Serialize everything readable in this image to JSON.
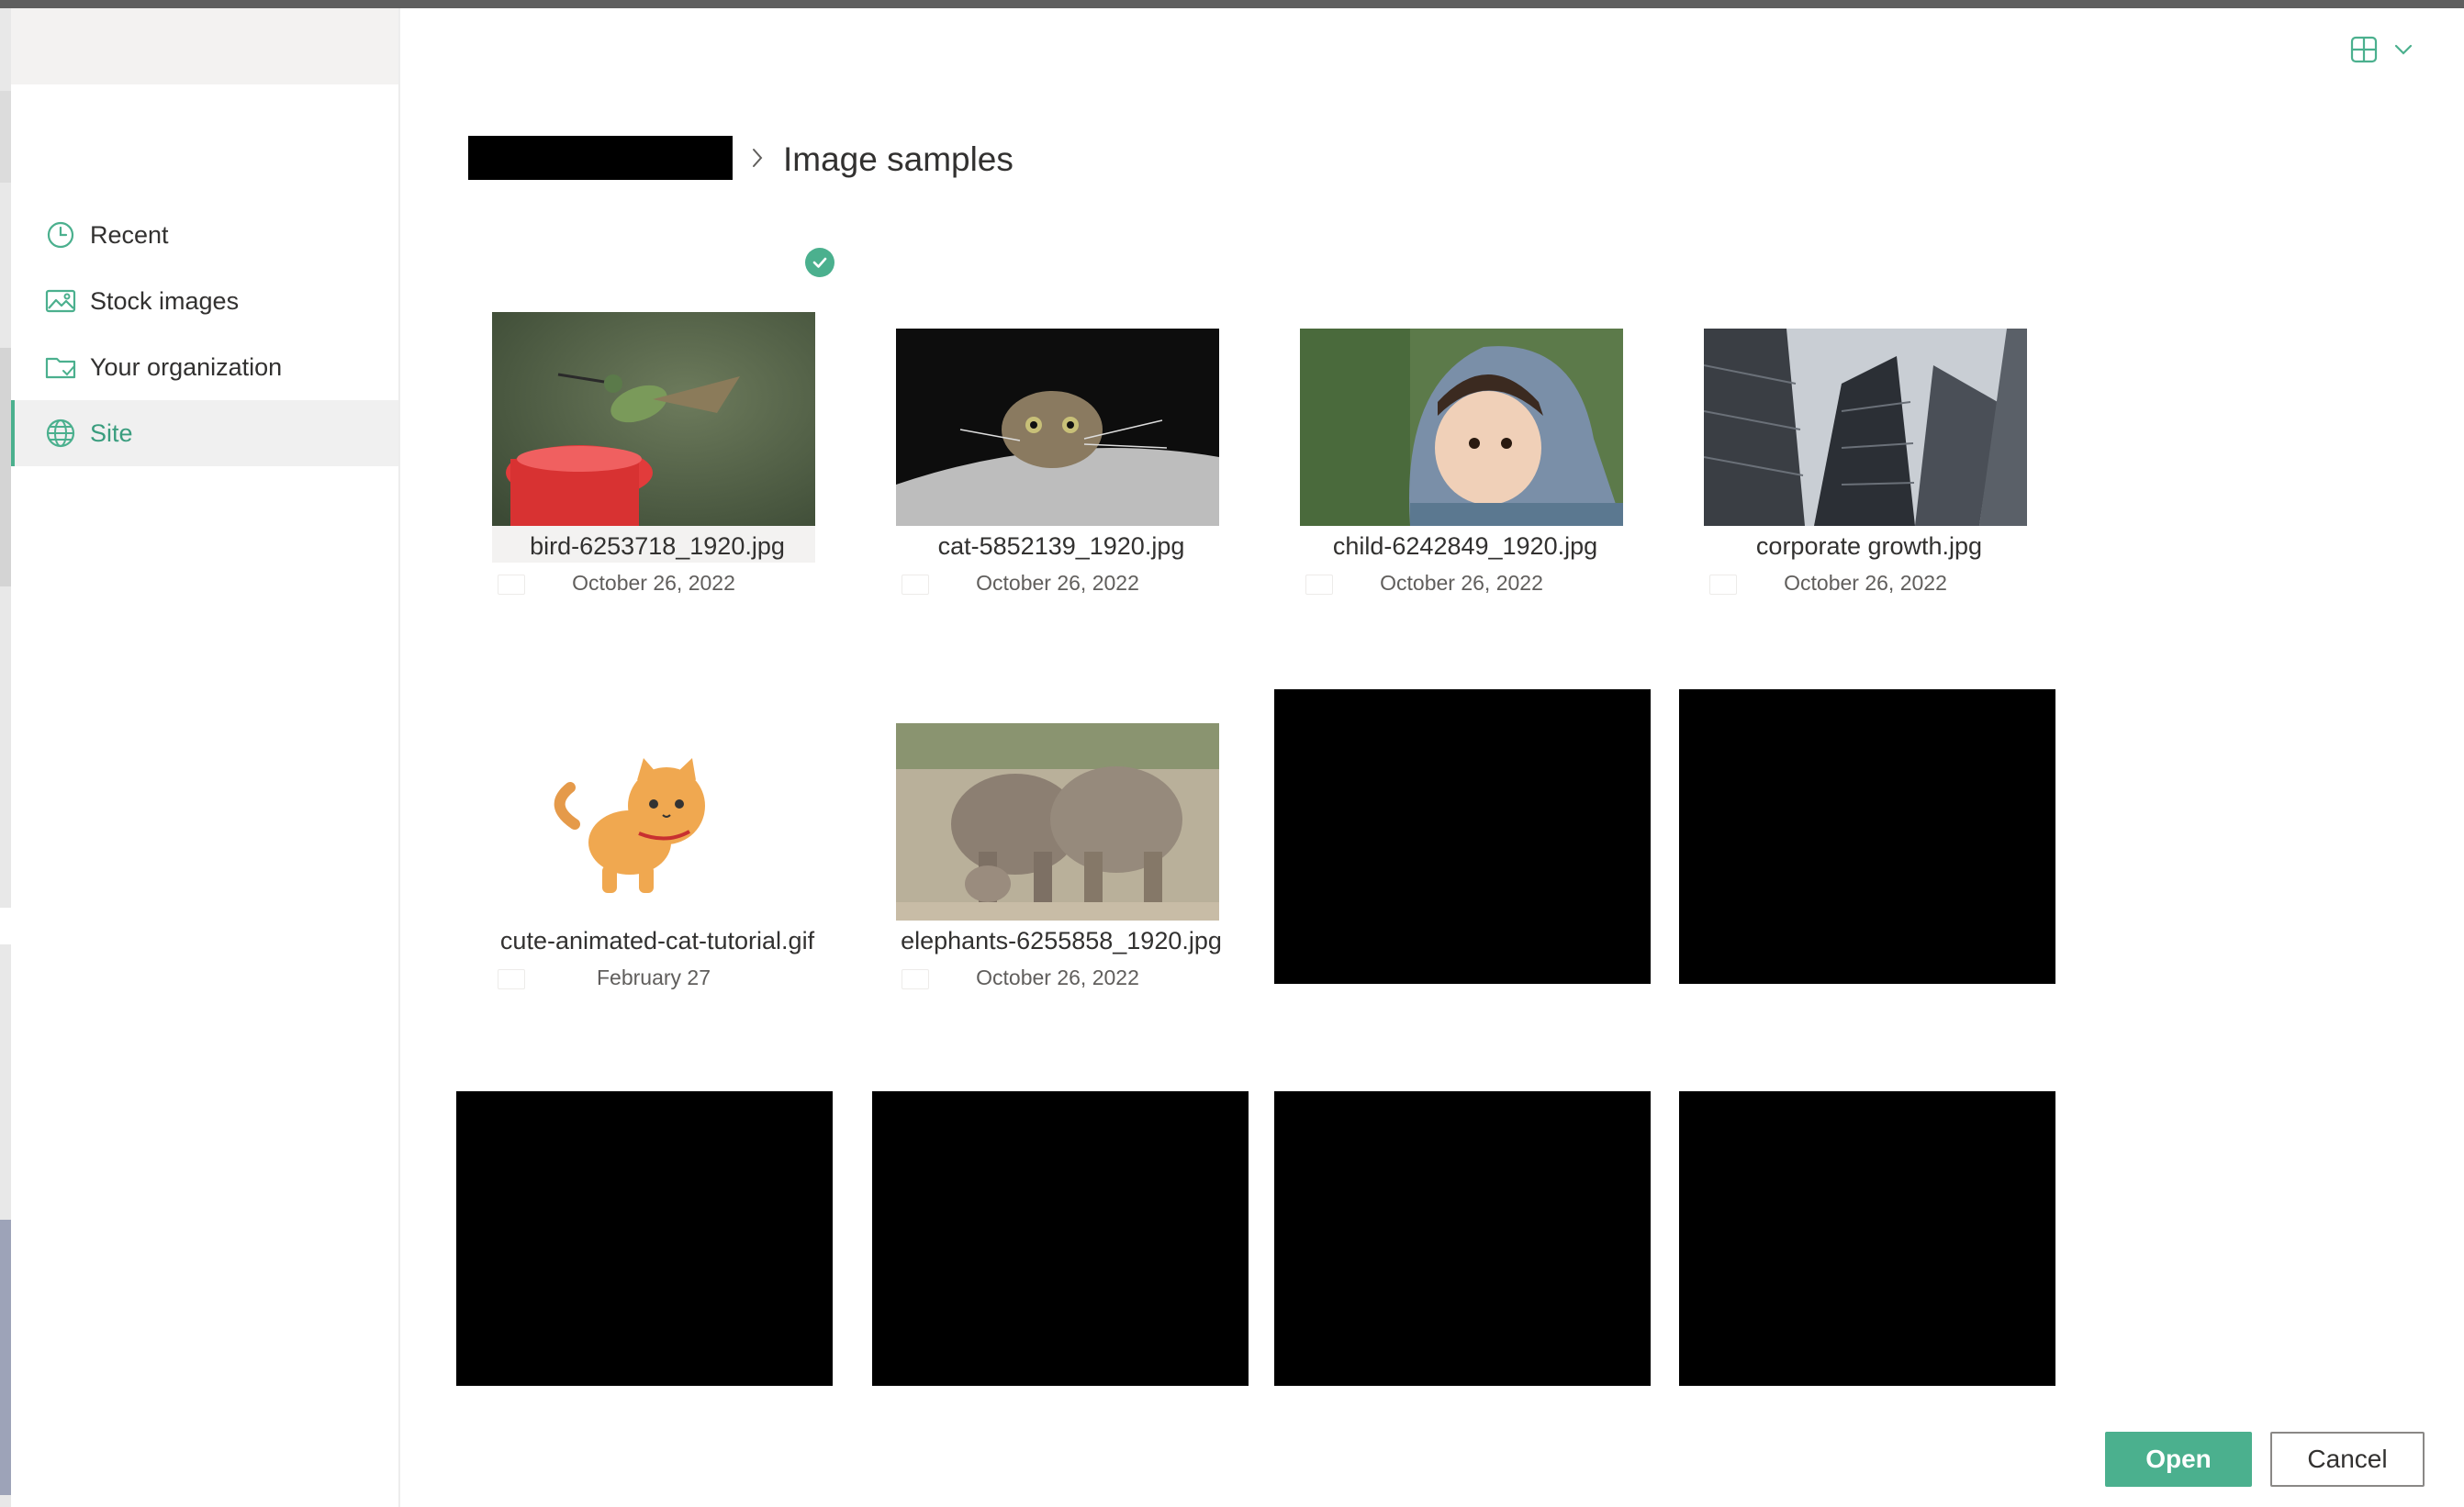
{
  "colors": {
    "accent": "#4bb08e",
    "selected_bg": "#f0f0f0",
    "text": "#323130",
    "muted": "#605e5c"
  },
  "nav": {
    "items": [
      {
        "label": "Recent",
        "icon": "clock-icon",
        "selected": false
      },
      {
        "label": "Stock images",
        "icon": "stock-images-icon",
        "selected": false
      },
      {
        "label": "Your organization",
        "icon": "organization-folder-icon",
        "selected": false
      },
      {
        "label": "Site",
        "icon": "globe-icon",
        "selected": true
      }
    ]
  },
  "view_switch": {
    "icon": "grid-view-icon",
    "dropdown_icon": "chevron-down-icon"
  },
  "breadcrumb": {
    "current": "Image samples",
    "separator_icon": "chevron-right-icon"
  },
  "files": [
    {
      "name": "bird-6253718_1920.jpg",
      "date": "October 26, 2022",
      "selected": true
    },
    {
      "name": "cat-5852139_1920.jpg",
      "date": "October 26, 2022",
      "selected": false
    },
    {
      "name": "child-6242849_1920.jpg",
      "date": "October 26, 2022",
      "selected": false
    },
    {
      "name": "corporate growth.jpg",
      "date": "October 26, 2022",
      "selected": false
    },
    {
      "name": "cute-animated-cat-tutorial.gif",
      "date": "February 27",
      "selected": false
    },
    {
      "name": "elephants-6255858_1920.jpg",
      "date": "October 26, 2022",
      "selected": false
    }
  ],
  "footer": {
    "open_label": "Open",
    "cancel_label": "Cancel"
  }
}
